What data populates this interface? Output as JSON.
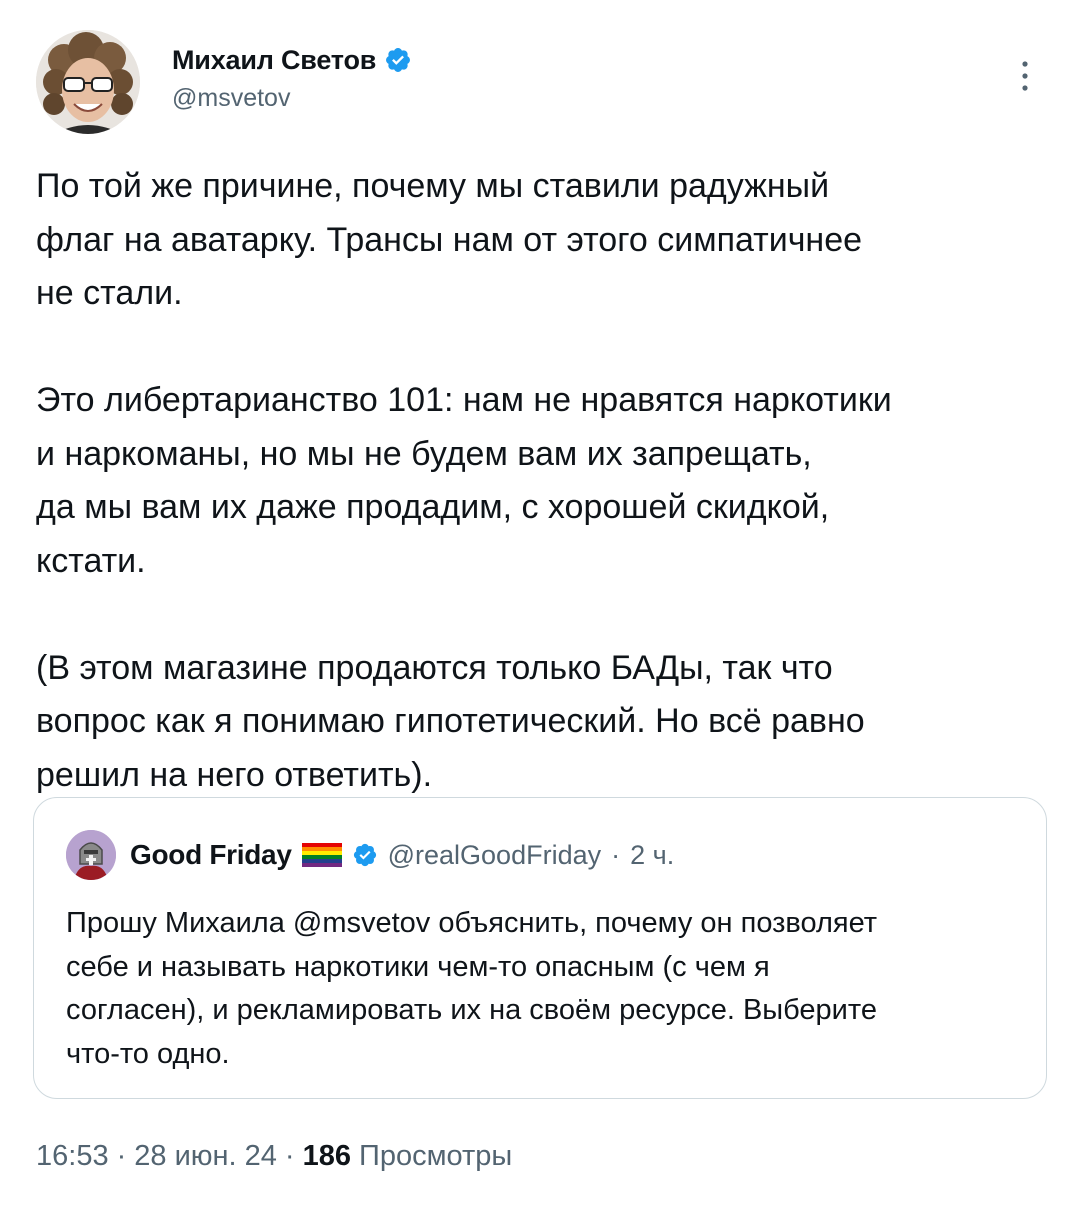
{
  "author": {
    "display_name": "Михаил Светов",
    "handle": "@msvetov"
  },
  "tweet": {
    "text": "По той же причине, почему мы ставили радужный\nфлаг на аватарку. Трансы нам от этого симпатичнее\nне стали.\n\nЭто либертарианство 101: нам не нравятся наркотики\nи наркоманы, но мы не будем вам их запрещать,\nда мы вам их даже продадим, с хорошей скидкой,\nкстати.\n\n(В этом магазине продаются только БАДы, так что\nвопрос как я понимаю гипотетический. Но всё равно\nрешил на него ответить)."
  },
  "quoted_tweet": {
    "display_name": "Good Friday",
    "handle": "@realGoodFriday",
    "separator": "·",
    "time": "2 ч.",
    "text": "Прошу Михаила @msvetov объяснить, почему он позволяет\nсебе и называть наркотики чем-то опасным (с чем я\nсогласен), и рекламировать их на своём ресурсе. Выберите\nчто-то одно."
  },
  "meta": {
    "time": "16:53",
    "separator1": "·",
    "date": "28 июн. 24",
    "separator2": "·",
    "views_count": "186",
    "views_label": "Просмотры"
  },
  "icons": {
    "verified": "verified-badge-icon",
    "more": "more-options-icon",
    "flag": "rainbow-flag-emoji"
  },
  "colors": {
    "verified_blue": "#1d9bf0",
    "secondary_text": "#536471",
    "primary_text": "#0f1419",
    "border": "#cfd9de"
  }
}
